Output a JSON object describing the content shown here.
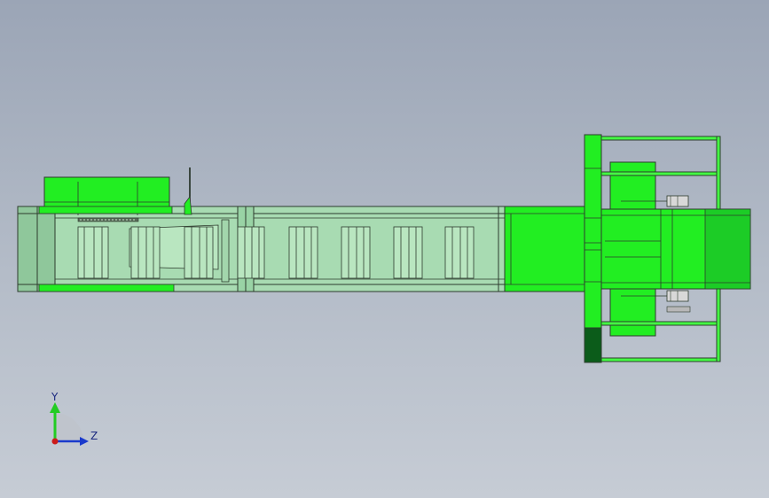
{
  "viewport": {
    "background_top": "#9ba5b6",
    "background_bottom": "#c6ccd5"
  },
  "model": {
    "name": "",
    "colors": {
      "body_translucent": "#9fd9ab",
      "panel_green": "#22ee22",
      "dark_green": "#0b5c1a",
      "edge": "#2d3b2d",
      "bright_green": "#44ff44"
    }
  },
  "triad": {
    "y_label": "Y",
    "z_label": "Z",
    "y_color": "#22cc22",
    "z_color": "#1a3acc",
    "origin_color": "#cc1a1a"
  }
}
